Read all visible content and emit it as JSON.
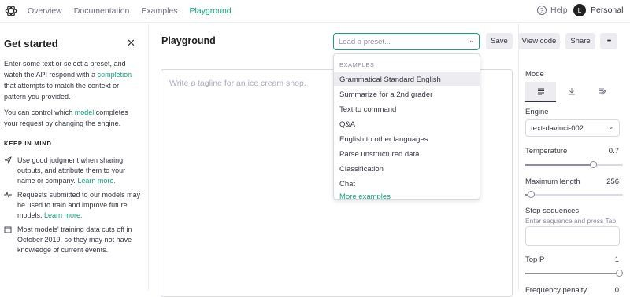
{
  "nav": {
    "items": [
      "Overview",
      "Documentation",
      "Examples",
      "Playground"
    ],
    "active": "Playground"
  },
  "help": {
    "label": "Help"
  },
  "user": {
    "initial": "L",
    "name": "Personal"
  },
  "sidebar": {
    "title": "Get started",
    "para1_a": "Enter some text or select a preset, and watch the API respond with a ",
    "para1_link": "completion",
    "para1_b": " that attempts to match the context or pattern you provided.",
    "para2_a": "You can control which ",
    "para2_link": "model",
    "para2_b": " completes your request by changing the engine.",
    "keep_in_mind": "KEEP IN MIND",
    "tips": [
      {
        "icon": "send-icon",
        "text": "Use good judgment when sharing outputs, and attribute them to your name or company. ",
        "link": "Learn more."
      },
      {
        "icon": "activity-icon",
        "text": "Requests submitted to our models may be used to train and improve future models. ",
        "link": "Learn more."
      },
      {
        "icon": "calendar-icon",
        "text": "Most models' training data cuts off in October 2019, so they may not have knowledge of current events.",
        "link": ""
      }
    ]
  },
  "main": {
    "title": "Playground",
    "preset_placeholder": "Load a preset...",
    "buttons": {
      "save": "Save",
      "view_code": "View code",
      "share": "Share",
      "more": "•••"
    },
    "editor_placeholder": "Write a tagline for an ice cream shop."
  },
  "dropdown": {
    "header": "EXAMPLES",
    "items": [
      "Grammatical Standard English",
      "Summarize for a 2nd grader",
      "Text to command",
      "Q&A",
      "English to other languages",
      "Parse unstructured data",
      "Classification",
      "Chat"
    ],
    "highlighted_index": 0,
    "more": "More examples"
  },
  "settings": {
    "mode_label": "Mode",
    "engine_label": "Engine",
    "engine_value": "text-davinci-002",
    "temperature_label": "Temperature",
    "temperature_value": "0.7",
    "temperature_fraction": 0.7,
    "max_length_label": "Maximum length",
    "max_length_value": "256",
    "max_length_fraction": 0.06,
    "stop_label": "Stop sequences",
    "stop_hint": "Enter sequence and press Tab",
    "top_p_label": "Top P",
    "top_p_value": "1",
    "top_p_fraction": 1.0,
    "freq_label": "Frequency penalty",
    "freq_value": "0"
  },
  "colors": {
    "accent": "#10a37f",
    "text": "#353740",
    "border": "#d9d9e3"
  }
}
